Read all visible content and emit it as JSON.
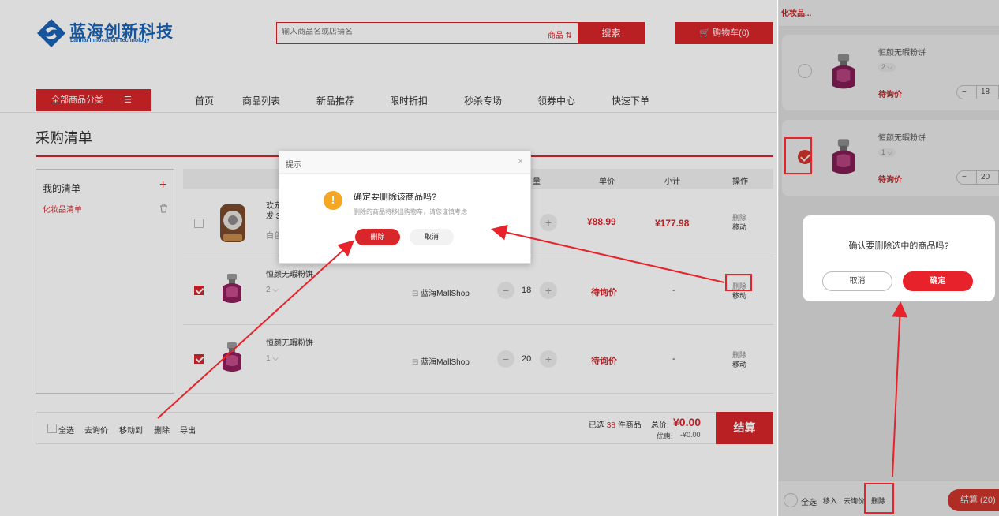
{
  "site": {
    "name_cn": "蓝海创新科技",
    "name_en": "Lanhai Innovation Technology"
  },
  "search": {
    "placeholder": "输入商品名或店铺名",
    "type_label": "商品 ⇅",
    "button": "搜索"
  },
  "cart": {
    "label": "购物车(0)"
  },
  "nav": {
    "category_button": "全部商品分类",
    "items": [
      "首页",
      "商品列表",
      "新品推荐",
      "限时折扣",
      "秒杀专场",
      "领券中心",
      "快速下单"
    ]
  },
  "page_title": "采购清单",
  "sidebar": {
    "title": "我的清单",
    "add": "+",
    "lists": [
      "化妆品清单"
    ]
  },
  "table": {
    "headers": {
      "qty": "量",
      "unit_price": "单价",
      "subtotal": "小计",
      "action": "操作"
    },
    "rows": [
      {
        "name_line1": "欢宠",
        "name_line2": "发 3",
        "spec": "白色",
        "qty": "",
        "price": "¥88.99",
        "subtotal": "¥177.98",
        "action_delete": "删除",
        "action_move": "移动",
        "checked": false
      },
      {
        "name_line1": "恒颜无暇粉饼",
        "spec": "2",
        "shop": "蓝海MallShop",
        "qty": "18",
        "price": "待询价",
        "subtotal": "-",
        "action_delete": "删除",
        "action_move": "移动",
        "checked": true
      },
      {
        "name_line1": "恒颜无暇粉饼",
        "spec": "1",
        "shop": "蓝海MallShop",
        "qty": "20",
        "price": "待询价",
        "subtotal": "-",
        "action_delete": "删除",
        "action_move": "移动",
        "checked": true
      }
    ]
  },
  "bottom_bar": {
    "select_all": "全选",
    "inquire": "去询价",
    "move_to": "移动到",
    "delete": "删除",
    "export": "导出",
    "selected_prefix": "已选",
    "selected_count": "38",
    "selected_suffix": "件商品",
    "total_label": "总价:",
    "total_value": "¥0.00",
    "discount_label": "优惠:",
    "discount_value": "-¥0.00",
    "checkout": "结算"
  },
  "dialog": {
    "title": "提示",
    "close": "×",
    "icon": "!",
    "message": "确定要删除该商品吗?",
    "sub": "删除的商品将移出购物车，请您谨慎考虑",
    "confirm": "删除",
    "cancel": "取消"
  },
  "mobile": {
    "tab": "化妆品...",
    "items": [
      {
        "name": "恒颜无暇粉饼",
        "spec": "2",
        "price": "待询价",
        "qty": "18",
        "minus": "−",
        "plus": "+",
        "checked": false
      },
      {
        "name": "恒颜无暇粉饼",
        "spec": "1",
        "price": "待询价",
        "qty": "20",
        "minus": "−",
        "plus": "+",
        "checked": true
      }
    ],
    "confirm": {
      "message": "确认要删除选中的商品吗?",
      "cancel": "取消",
      "ok": "确定"
    },
    "bottom": {
      "select_all": "全选",
      "move_in": "移入",
      "inquire": "去询价",
      "delete": "删除",
      "checkout": "结算 (20)"
    }
  },
  "colors": {
    "brand_red": "#d8262a",
    "logo_blue": "#1a62b6",
    "annotation_red": "#e8222a",
    "warning_yellow": "#f5a623"
  }
}
